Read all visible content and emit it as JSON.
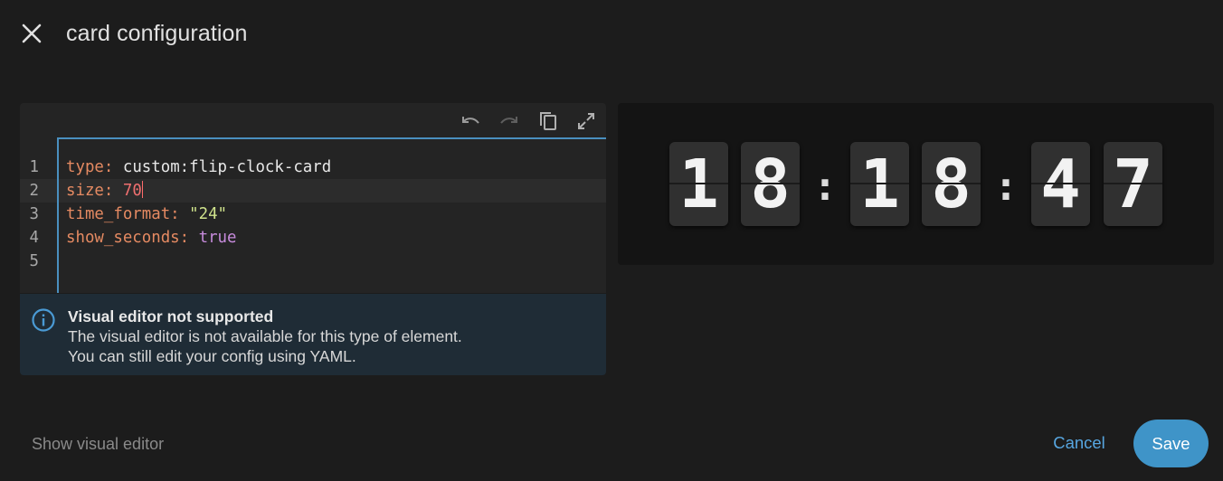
{
  "header": {
    "title": "card configuration"
  },
  "toolbar": {
    "icons": [
      "undo-icon",
      "redo-icon",
      "copy-icon",
      "fullscreen-icon"
    ]
  },
  "editor": {
    "lines": [
      {
        "number": "1",
        "key": "type",
        "value": "custom:flip-clock-card"
      },
      {
        "number": "2",
        "key": "size",
        "value": "70"
      },
      {
        "number": "3",
        "key": "time_format",
        "value": "\"24\""
      },
      {
        "number": "4",
        "key": "show_seconds",
        "value": "true"
      },
      {
        "number": "5",
        "key": "",
        "value": ""
      }
    ],
    "colon": ":"
  },
  "alert": {
    "title": "Visual editor not supported",
    "line1": "The visual editor is not available for this type of element.",
    "line2": "You can still edit your config using YAML."
  },
  "clock": {
    "digits": [
      "1",
      "8",
      "1",
      "8",
      "4",
      "7"
    ],
    "separator": ":"
  },
  "footer": {
    "show_visual_editor": "Show visual editor",
    "cancel": "Cancel",
    "save": "Save"
  },
  "colors": {
    "accent": "#3f94c8",
    "link": "#57a6e0",
    "background": "#1c1c1c"
  }
}
